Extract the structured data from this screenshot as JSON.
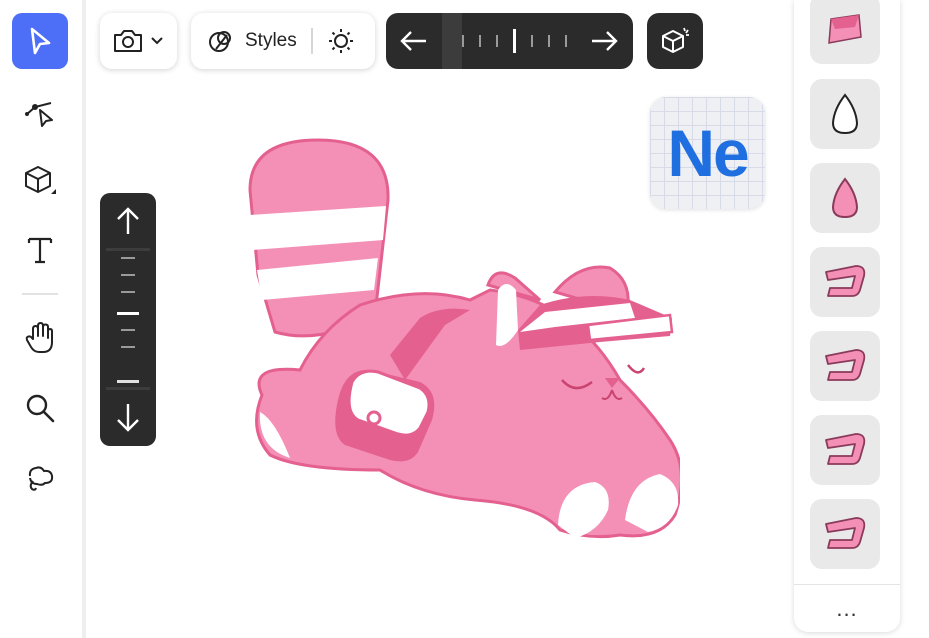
{
  "toolbar": {
    "tools": [
      {
        "name": "select-tool",
        "icon": "pointer-arrow-icon",
        "active": true
      },
      {
        "name": "path-tool",
        "icon": "vector-path-icon"
      },
      {
        "name": "3d-object-tool",
        "icon": "cube-icon"
      },
      {
        "name": "text-tool",
        "icon": "text-t-icon"
      },
      {
        "name": "hand-tool",
        "icon": "hand-icon"
      },
      {
        "name": "zoom-tool",
        "icon": "magnifier-icon"
      },
      {
        "name": "lasso-tool",
        "icon": "lasso-icon"
      }
    ]
  },
  "topbar": {
    "camera_icon": "camera-icon",
    "styles_label": "Styles",
    "light_icon": "sun-icon",
    "render_icon": "render-cube-icon"
  },
  "badge": {
    "text": "Ne"
  },
  "panel": {
    "swatches": [
      "pink-wedge-shape",
      "white-drop-shape",
      "pink-drop-shape",
      "pink-bracket-shape",
      "pink-bracket-shape",
      "pink-bracket-shape",
      "pink-bracket-shape"
    ],
    "more_label": "..."
  },
  "colors": {
    "accent": "#4d6ef7",
    "dark": "#2b2b2b",
    "pink": "#f48fb6",
    "pink_dark": "#e4608f",
    "badge_blue": "#1f6fe0"
  }
}
